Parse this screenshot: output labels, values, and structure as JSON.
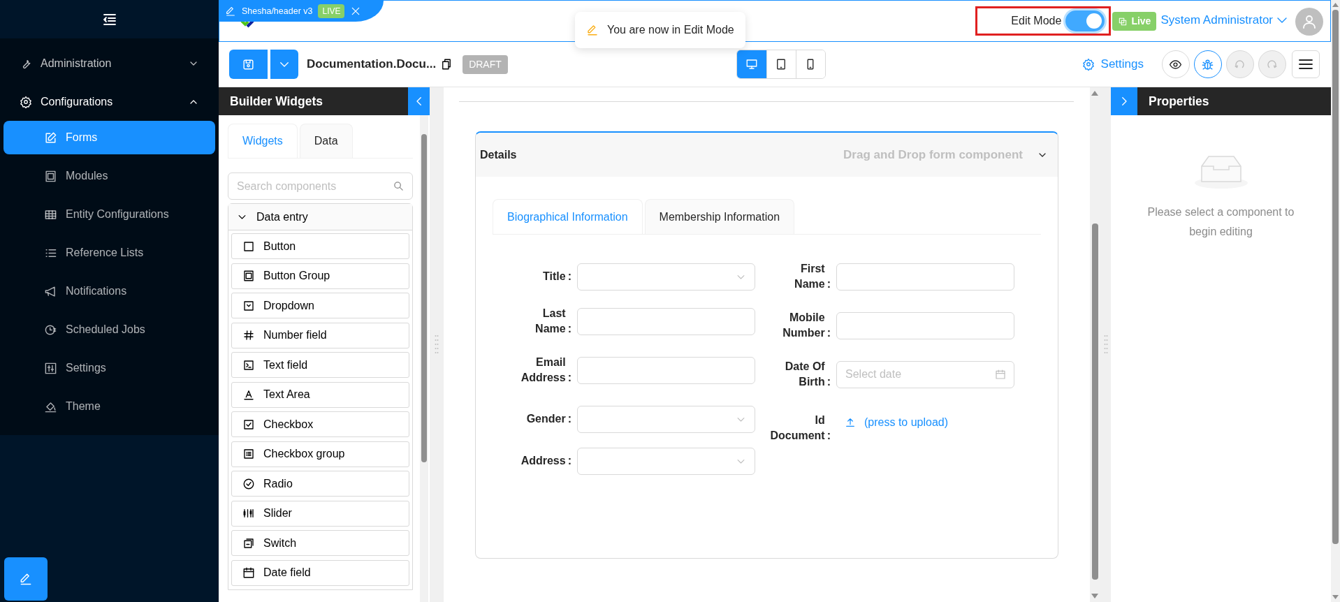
{
  "sidebar": {
    "groups": [
      {
        "label": "Administration",
        "kind": "wrench",
        "expanded": false
      },
      {
        "label": "Configurations",
        "kind": "gear",
        "expanded": true,
        "children": [
          {
            "label": "Forms",
            "kind": "edit",
            "selected": true
          },
          {
            "label": "Modules",
            "kind": "module",
            "selected": false
          },
          {
            "label": "Entity Configurations",
            "kind": "table",
            "selected": false
          },
          {
            "label": "Reference Lists",
            "kind": "list",
            "selected": false
          },
          {
            "label": "Notifications",
            "kind": "megaphone",
            "selected": false
          },
          {
            "label": "Scheduled Jobs",
            "kind": "clock",
            "selected": false
          },
          {
            "label": "Settings",
            "kind": "sliders",
            "selected": false
          },
          {
            "label": "Theme",
            "kind": "paint",
            "selected": false
          }
        ]
      }
    ]
  },
  "editor_tab": {
    "title": "Shesha/header v3",
    "badge": "LIVE"
  },
  "toast": {
    "text": "You are now in Edit Mode"
  },
  "edit_mode": {
    "label": "Edit Mode",
    "on": true
  },
  "live_badge": "Live",
  "user": {
    "name": "System Administrator"
  },
  "toolbar": {
    "form_name": "Documentation.Docu...",
    "status": "DRAFT",
    "devices": [
      {
        "kind": "desktop",
        "selected": true
      },
      {
        "kind": "tablet",
        "selected": false
      },
      {
        "kind": "mobile",
        "selected": false
      }
    ],
    "settings_link": "Settings",
    "actions": [
      {
        "kind": "eye",
        "active": false,
        "disabled": false
      },
      {
        "kind": "bug",
        "active": true,
        "disabled": false
      },
      {
        "kind": "undo",
        "active": false,
        "disabled": true
      },
      {
        "kind": "redo",
        "active": false,
        "disabled": true
      },
      {
        "kind": "menu",
        "active": false,
        "disabled": false
      }
    ]
  },
  "widgets_panel": {
    "title": "Builder Widgets",
    "tabs": [
      {
        "label": "Widgets",
        "selected": true
      },
      {
        "label": "Data",
        "selected": false
      }
    ],
    "search": {
      "placeholder": "Search components"
    },
    "group": {
      "label": "Data entry",
      "expanded": true,
      "items": [
        {
          "label": "Button",
          "kind": "square"
        },
        {
          "label": "Button Group",
          "kind": "group"
        },
        {
          "label": "Dropdown",
          "kind": "dropdown"
        },
        {
          "label": "Number field",
          "kind": "hash"
        },
        {
          "label": "Text field",
          "kind": "terminal"
        },
        {
          "label": "Text Area",
          "kind": "letter"
        },
        {
          "label": "Checkbox",
          "kind": "check"
        },
        {
          "label": "Checkbox group",
          "kind": "checklist"
        },
        {
          "label": "Radio",
          "kind": "radio"
        },
        {
          "label": "Slider",
          "kind": "slider"
        },
        {
          "label": "Switch",
          "kind": "switch"
        },
        {
          "label": "Date field",
          "kind": "calendar"
        }
      ]
    }
  },
  "canvas": {
    "panel": {
      "title": "Details",
      "hint": "Drag and Drop form component",
      "expanded": true
    },
    "tabs": [
      {
        "label": "Biographical Information",
        "selected": true
      },
      {
        "label": "Membership Information",
        "selected": false
      }
    ],
    "columns": [
      [
        {
          "label": "Title",
          "colon": ":",
          "kind": "select"
        },
        {
          "label": "Last Name",
          "colon": ":",
          "kind": "text"
        },
        {
          "label": "Email Address",
          "colon": ":",
          "kind": "text"
        },
        {
          "label": "Gender",
          "colon": ":",
          "kind": "select"
        },
        {
          "label": "Address",
          "colon": ":",
          "kind": "select"
        }
      ],
      [
        {
          "label": "First Name",
          "colon": ":",
          "kind": "text"
        },
        {
          "label": "Mobile Number",
          "colon": ":",
          "kind": "text"
        },
        {
          "label": "Date Of Birth",
          "colon": ":",
          "kind": "date",
          "placeholder": "Select date"
        },
        {
          "label": "Id Document",
          "colon": ":",
          "kind": "upload",
          "text": "(press to upload)"
        }
      ]
    ]
  },
  "properties_panel": {
    "title": "Properties",
    "empty_text": "Please select a component to begin editing"
  }
}
